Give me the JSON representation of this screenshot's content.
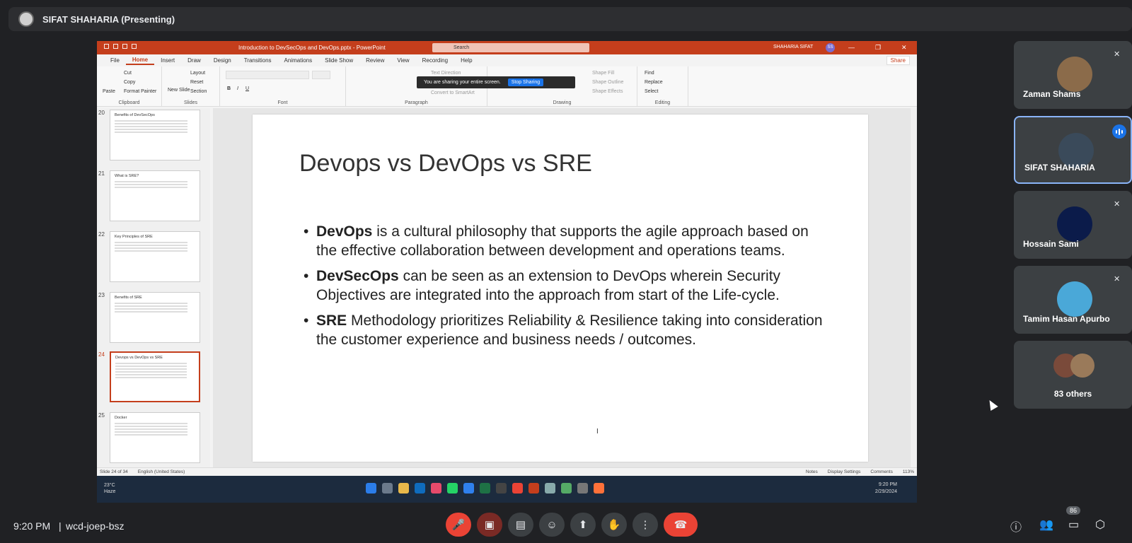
{
  "meet": {
    "presenter_label": "SIFAT SHAHARIA (Presenting)",
    "time": "9:20 PM",
    "separator": "|",
    "meeting_code": "wcd-joep-bsz",
    "people_count": "86"
  },
  "powerpoint": {
    "window_title": "Introduction to DevSecOps and DevOps.pptx - PowerPoint",
    "search_placeholder": "Search",
    "user_name": "SHAHARIA SIFAT",
    "user_initials": "SS",
    "tabs": [
      "File",
      "Home",
      "Insert",
      "Draw",
      "Design",
      "Transitions",
      "Animations",
      "Slide Show",
      "Review",
      "View",
      "Recording",
      "Help"
    ],
    "share_label": "Share",
    "ribbon": {
      "clipboard": {
        "label": "Clipboard",
        "paste": "Paste",
        "cut": "Cut",
        "copy": "Copy",
        "format_painter": "Format Painter"
      },
      "slides": {
        "label": "Slides",
        "new_slide": "New Slide",
        "layout": "Layout",
        "reset": "Reset",
        "section": "Section"
      },
      "font": {
        "label": "Font"
      },
      "paragraph": {
        "label": "Paragraph",
        "text_direction": "Text Direction",
        "convert": "Convert to SmartArt"
      },
      "drawing": {
        "label": "Drawing",
        "shape_fill": "Shape Fill",
        "shape_outline": "Shape Outline",
        "shape_effects": "Shape Effects"
      },
      "editing": {
        "label": "Editing",
        "find": "Find",
        "replace": "Replace",
        "select": "Select"
      }
    },
    "share_banner": {
      "text": "You are sharing your entire screen.",
      "stop": "Stop Sharing"
    },
    "thumbnails": [
      {
        "num": "20",
        "title": "Benefits of DevSecOps"
      },
      {
        "num": "21",
        "title": "What is SRE?"
      },
      {
        "num": "22",
        "title": "Key Principles of SRE"
      },
      {
        "num": "23",
        "title": "Benefits of SRE"
      },
      {
        "num": "24",
        "title": "Devops vs DevOps vs SRE"
      },
      {
        "num": "25",
        "title": "Docker"
      }
    ],
    "slide": {
      "title": "Devops vs DevOps vs SRE",
      "bullets": [
        {
          "bold": "DevOps",
          "text": " is a cultural philosophy that supports the agile approach based on the effective collaboration between development and operations teams."
        },
        {
          "bold": "DevSecOps",
          "text": " can be seen as an extension to DevOps wherein Security Objectives are integrated into the approach from start of the Life-cycle."
        },
        {
          "bold": "SRE",
          "text": " Methodology prioritizes Reliability & Resilience taking into consideration the customer experience and business needs / outcomes."
        }
      ]
    },
    "status": {
      "slide_count": "Slide 24 of 34",
      "language": "English (United States)",
      "notes": "Notes",
      "display_settings": "Display Settings",
      "comments": "Comments",
      "zoom": "113%"
    }
  },
  "windows": {
    "weather_temp": "23°C",
    "weather_desc": "Haze",
    "clock_time": "9:20 PM",
    "clock_date": "2/29/2024"
  },
  "participants": [
    {
      "name": "Zaman Shams",
      "muted": true
    },
    {
      "name": "SIFAT SHAHARIA",
      "muted": false,
      "speaking": true
    },
    {
      "name": "Hossain Sami",
      "muted": true
    },
    {
      "name": "Tamim Hasan Apurbo",
      "muted": true
    },
    {
      "name": "83 others"
    }
  ],
  "colors": {
    "ppt_accent": "#c43e1c",
    "meet_bg": "#202124",
    "end_call": "#ea4335",
    "active_border": "#8ab4f8"
  }
}
